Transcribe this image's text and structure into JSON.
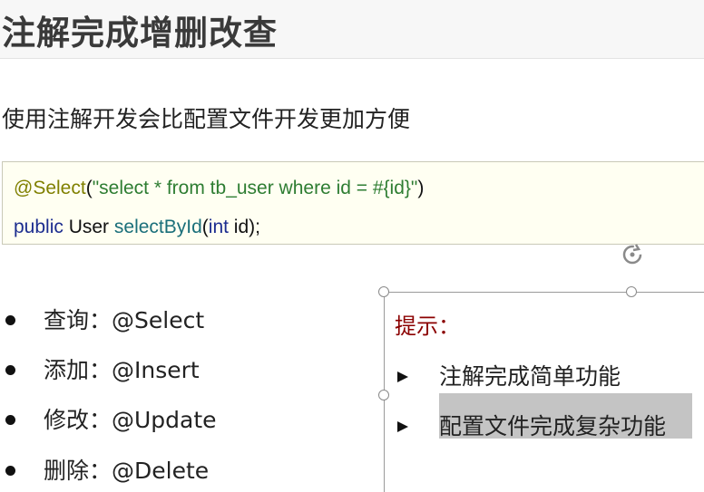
{
  "slide": {
    "title": "注解完成增删改查",
    "subtitle": "使用注解开发会比配置文件开发更加方便"
  },
  "code": {
    "line1": {
      "annotation": "@Select",
      "open": "(",
      "string": "\"select * from tb_user where id = #{id}\"",
      "close": ")"
    },
    "line2": {
      "kw_public": "public",
      "type": " User ",
      "method": "selectById",
      "open": "(",
      "kw_int": "int",
      "rest": " id);"
    }
  },
  "bullets": [
    {
      "label": "查询：@Select"
    },
    {
      "label": "添加：@Insert"
    },
    {
      "label": "修改：@Update"
    },
    {
      "label": "删除：@Delete"
    }
  ],
  "tip": {
    "title": "提示：",
    "items": [
      {
        "label": "注解完成简单功能"
      },
      {
        "label": "配置文件完成复杂功能"
      }
    ]
  },
  "colors": {
    "tip_title": "#8b0000",
    "annotation": "#808000",
    "string": "#2e7d32",
    "keyword": "#1c2d8f",
    "method": "#1a6f7a",
    "highlight": "#c4c4c4"
  }
}
